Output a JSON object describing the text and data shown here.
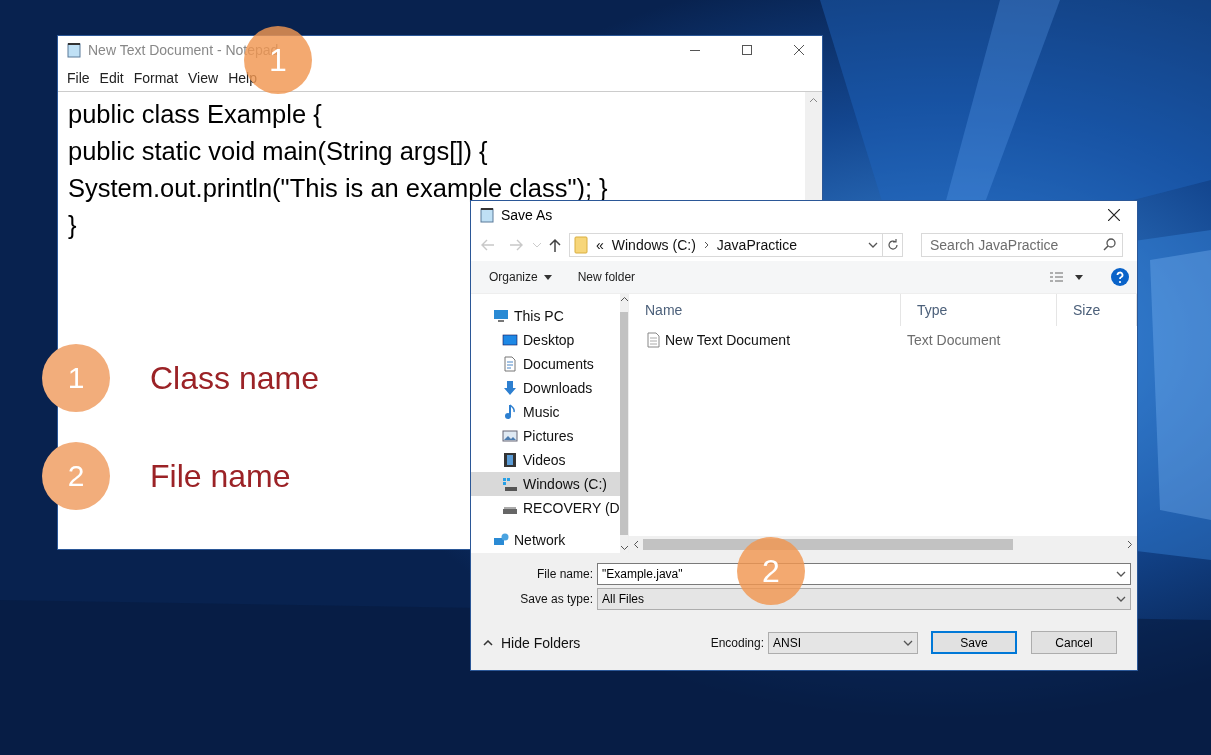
{
  "notepad": {
    "title": "New Text Document - Notepad",
    "menu": [
      "File",
      "Edit",
      "Format",
      "View",
      "Help"
    ],
    "lines": [
      "public class Example {",
      "public static void main(String args[]) {",
      "System.out.println(\"This is an example class\"); }",
      "}"
    ]
  },
  "annotations": [
    {
      "number": "1",
      "label": "Class name"
    },
    {
      "number": "2",
      "label": "File name"
    }
  ],
  "callouts": [
    "1",
    "2"
  ],
  "save_as": {
    "title": "Save As",
    "address_prefix": "«",
    "path": [
      "Windows (C:)",
      "JavaPractice"
    ],
    "search_placeholder": "Search JavaPractice",
    "toolbar": [
      "Organize",
      "New folder"
    ],
    "nav": [
      {
        "label": "This PC",
        "kind": "pc",
        "selected": false,
        "children": [
          {
            "label": "Desktop",
            "kind": "desktop",
            "selected": false
          },
          {
            "label": "Documents",
            "kind": "documents",
            "selected": false
          },
          {
            "label": "Downloads",
            "kind": "downloads",
            "selected": false
          },
          {
            "label": "Music",
            "kind": "music",
            "selected": false
          },
          {
            "label": "Pictures",
            "kind": "pictures",
            "selected": false
          },
          {
            "label": "Videos",
            "kind": "videos",
            "selected": false
          },
          {
            "label": "Windows (C:)",
            "kind": "system-drive",
            "selected": true
          },
          {
            "label": "RECOVERY (D",
            "kind": "drive",
            "selected": false
          }
        ]
      },
      {
        "label": "Network",
        "kind": "network",
        "selected": false
      }
    ],
    "columns": [
      "Name",
      "Type",
      "Size"
    ],
    "files": [
      {
        "name": "New Text Document",
        "type": "Text Document"
      }
    ],
    "file_name_label": "File name:",
    "file_name": "\"Example.java\"",
    "type_label": "Save as type:",
    "type": "All Files",
    "hide_folders": "Hide Folders",
    "encoding_label": "Encoding:",
    "encoding": "ANSI",
    "buttons": [
      "Save",
      "Cancel"
    ]
  }
}
